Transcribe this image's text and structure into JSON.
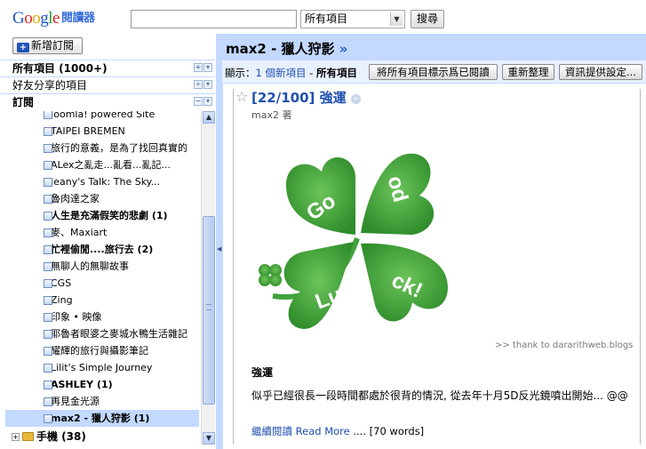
{
  "header": {
    "logo_google": "Google",
    "logo_reader": "閱讀器",
    "search_value": "",
    "scope_value": "所有項目",
    "search_button": "搜尋"
  },
  "nav": {
    "add_subscription": "新增訂閱",
    "all_items": "所有項目 (1000+)",
    "shared_items": "好友分享的項目",
    "subscriptions": "訂閱",
    "items": [
      {
        "label": "Joomla! powered Site",
        "bold": false
      },
      {
        "label": "TAIPEI BREMEN",
        "bold": false
      },
      {
        "label": "旅行的意義，是為了找回真實的",
        "bold": false
      },
      {
        "label": "ALex之亂走...亂看...亂記...",
        "bold": false
      },
      {
        "label": "Jeany's Talk: The Sky...",
        "bold": false
      },
      {
        "label": "魯肉達之家",
        "bold": false
      },
      {
        "label": "人生是充滿假笑的悲劇 (1)",
        "bold": true
      },
      {
        "label": "麥、Maxiart",
        "bold": false
      },
      {
        "label": "忙裡偷閒....旅行去 (2)",
        "bold": true
      },
      {
        "label": "無聊人的無聊故事",
        "bold": false
      },
      {
        "label": "CGS",
        "bold": false
      },
      {
        "label": "Zing",
        "bold": false
      },
      {
        "label": "印象 • 映像",
        "bold": false
      },
      {
        "label": "耶魯者眼婆之麥城水鴨生活雜記",
        "bold": false
      },
      {
        "label": "耀輝的旅行與攝影筆記",
        "bold": false
      },
      {
        "label": "Lilit's Simple Journey",
        "bold": false
      },
      {
        "label": "ASHLEY (1)",
        "bold": true
      },
      {
        "label": "再見金光源",
        "bold": false
      },
      {
        "label": "max2 - 獵人狩影 (1)",
        "bold": true,
        "selected": true
      }
    ],
    "folder": "手機 (38)"
  },
  "main": {
    "title": "max2 - 獵人狩影",
    "title_arrow": "»",
    "show_label": "顯示：",
    "new_items_link": "1 個新項目",
    "separator": " - ",
    "all_items_current": "所有項目",
    "mark_all_read": "將所有項目標示爲已閱讀",
    "refresh": "重新整理",
    "feed_settings": "資訊提供設定..."
  },
  "entry": {
    "title": "[22/100] 強運",
    "author": "max2 著",
    "caption": ">> thank to dararithweb.blogs",
    "heading": "強運",
    "body": "似乎已經很長一段時間都處於很背的情況, 從去年十月5D反光鏡噴出開始... @@",
    "continue_label": "繼續閱讀",
    "read_more": "Read More",
    "word_count": ".... [70 words]",
    "clover_words": [
      "Go",
      "od",
      "Lu",
      "ck!"
    ]
  },
  "colors": {
    "accent": "#c3d9ff",
    "link": "#1e4fb0",
    "clover": "#3fa33a"
  }
}
